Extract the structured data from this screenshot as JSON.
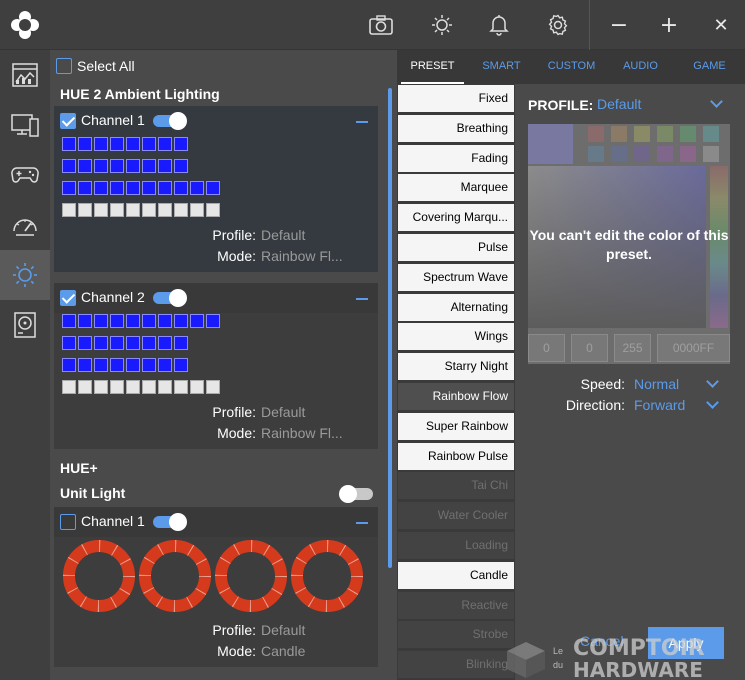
{
  "titlebar": {
    "icons": [
      "camera-icon",
      "brightness-icon",
      "bell-icon",
      "gear-icon"
    ],
    "window": {
      "minimize": "−",
      "maximize": "+",
      "close": "✕"
    }
  },
  "sidebar": {
    "items": [
      {
        "icon": "dashboard-icon"
      },
      {
        "icon": "pc-icon"
      },
      {
        "icon": "gamepad-icon"
      },
      {
        "icon": "speedometer-icon"
      },
      {
        "icon": "lighting-icon",
        "active": true
      },
      {
        "icon": "drive-icon"
      }
    ]
  },
  "devices": {
    "select_all": "Select All",
    "hue2": {
      "title": "HUE 2 Ambient Lighting",
      "channel1": {
        "label": "Channel 1",
        "checked": true,
        "profile_key": "Profile:",
        "profile_val": "Default",
        "mode_key": "Mode:",
        "mode_val": "Rainbow Fl..."
      },
      "channel2": {
        "label": "Channel 2",
        "checked": true,
        "profile_key": "Profile:",
        "profile_val": "Default",
        "mode_key": "Mode:",
        "mode_val": "Rainbow Fl..."
      }
    },
    "hueplus": {
      "title": "HUE+",
      "unit_light": "Unit Light",
      "channel1": {
        "label": "Channel 1",
        "checked": false,
        "profile_key": "Profile:",
        "profile_val": "Default",
        "mode_key": "Mode:",
        "mode_val": "Candle"
      }
    }
  },
  "tabs": [
    "PRESET",
    "SMART",
    "CUSTOM",
    "AUDIO",
    "GAME"
  ],
  "presets": [
    {
      "label": "Fixed",
      "state": "normal"
    },
    {
      "label": "Breathing",
      "state": "normal"
    },
    {
      "label": "Fading",
      "state": "normal"
    },
    {
      "label": "Marquee",
      "state": "normal"
    },
    {
      "label": "Covering Marqu...",
      "state": "normal"
    },
    {
      "label": "Pulse",
      "state": "normal"
    },
    {
      "label": "Spectrum Wave",
      "state": "normal"
    },
    {
      "label": "Alternating",
      "state": "normal"
    },
    {
      "label": "Wings",
      "state": "normal"
    },
    {
      "label": "Starry Night",
      "state": "normal"
    },
    {
      "label": "Rainbow Flow",
      "state": "selected"
    },
    {
      "label": "Super Rainbow",
      "state": "normal"
    },
    {
      "label": "Rainbow Pulse",
      "state": "normal"
    },
    {
      "label": "Tai Chi",
      "state": "disabled"
    },
    {
      "label": "Water Cooler",
      "state": "disabled"
    },
    {
      "label": "Loading",
      "state": "disabled"
    },
    {
      "label": "Candle",
      "state": "normal"
    },
    {
      "label": "Reactive",
      "state": "disabled"
    },
    {
      "label": "Strobe",
      "state": "disabled"
    },
    {
      "label": "Blinking",
      "state": "disabled"
    }
  ],
  "settings": {
    "profile_label": "PROFILE:",
    "profile_value": "Default",
    "locked_message": "You can't edit the color of this preset.",
    "color_inputs": [
      "0",
      "0",
      "255",
      "0000FF"
    ],
    "speed_label": "Speed:",
    "speed_value": "Normal",
    "direction_label": "Direction:",
    "direction_value": "Forward",
    "cancel": "Cancel",
    "apply": "Apply"
  },
  "watermark": {
    "le": "Le",
    "du": "du",
    "line1": "COMPTOIR",
    "line2": "HARDWARE"
  },
  "colors": {
    "accent": "#5b9be9",
    "led_blue": "#1a1aff",
    "fan_red": "#d63a1c"
  }
}
